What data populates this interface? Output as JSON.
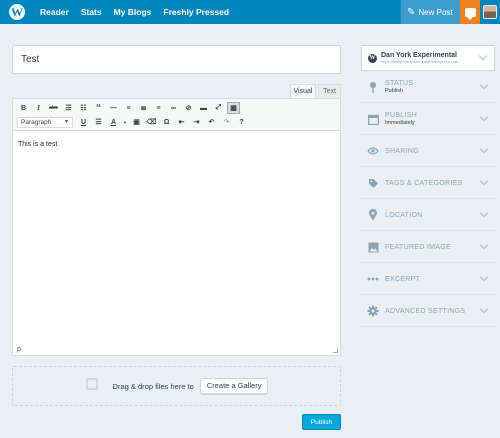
{
  "masterbar": {
    "nav": [
      "Reader",
      "Stats",
      "My Blogs",
      "Freshly Pressed"
    ],
    "new_post": "New Post"
  },
  "editor": {
    "title": "Test",
    "tabs": [
      "Visual",
      "Text"
    ],
    "format_select": "Paragraph",
    "content": "This is a test",
    "path": "p"
  },
  "media": {
    "drop_text": "Drag & drop files here to",
    "gallery_button": "Create a Gallery"
  },
  "publish_button": "Publish",
  "sidebar": {
    "site": {
      "name": "Dan York Experimental",
      "url": "https://danyorkexperimental.wordpress.com"
    },
    "sections": [
      {
        "label": "STATUS",
        "sub": "Publish",
        "icon": "pin-icon"
      },
      {
        "label": "PUBLISH",
        "sub": "Immediately",
        "icon": "calendar-icon"
      },
      {
        "label": "SHARING",
        "icon": "share-icon"
      },
      {
        "label": "TAGS & CATEGORIES",
        "icon": "tag-icon"
      },
      {
        "label": "LOCATION",
        "icon": "location-icon"
      },
      {
        "label": "FEATURED IMAGE",
        "icon": "image-icon"
      },
      {
        "label": "EXCERPT",
        "icon": "ellipsis-icon"
      },
      {
        "label": "ADVANCED SETTINGS",
        "icon": "cog-icon"
      }
    ]
  },
  "colors": {
    "masterbar": "#0087be",
    "notification": "#f0821e",
    "publish": "#00aadc"
  }
}
